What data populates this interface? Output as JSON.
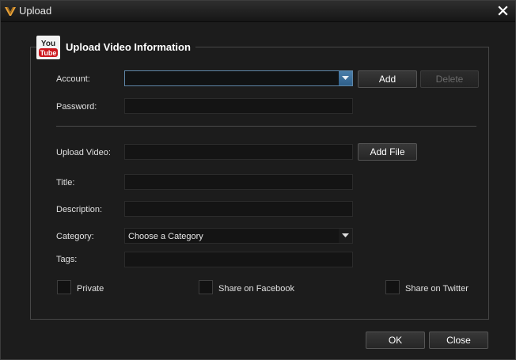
{
  "window": {
    "title": "Upload"
  },
  "section": {
    "logo_text_top": "You",
    "logo_text_bottom": "Tube",
    "title": "Upload Video Information"
  },
  "account": {
    "label": "Account:",
    "value": "",
    "add_label": "Add",
    "delete_label": "Delete"
  },
  "password": {
    "label": "Password:",
    "value": ""
  },
  "upload_video": {
    "label": "Upload Video:",
    "value": "",
    "add_file_label": "Add File"
  },
  "title_field": {
    "label": "Title:",
    "value": ""
  },
  "description": {
    "label": "Description:",
    "value": ""
  },
  "category": {
    "label": "Category:",
    "selected": "Choose a Category"
  },
  "tags": {
    "label": "Tags:",
    "value": ""
  },
  "options": {
    "private_label": "Private",
    "private_checked": false,
    "facebook_label": "Share on Facebook",
    "facebook_checked": false,
    "twitter_label": "Share on Twitter",
    "twitter_checked": false
  },
  "footer": {
    "ok_label": "OK",
    "close_label": "Close"
  },
  "colors": {
    "background": "#1c1c1c",
    "field_background": "#141414",
    "focus_border": "#5f87a8",
    "combo_arrow_blue": "#3d6f99",
    "youtube_red": "#cc181e"
  }
}
